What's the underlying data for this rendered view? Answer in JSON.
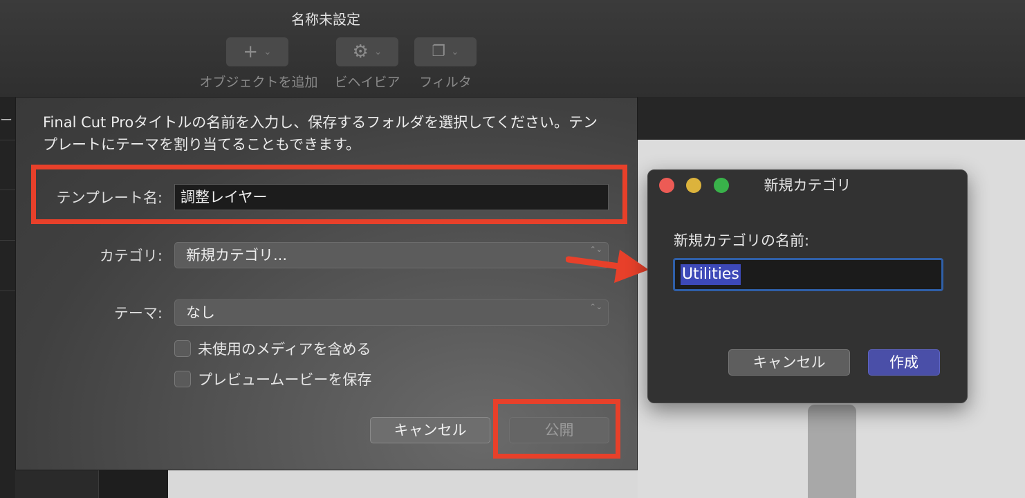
{
  "window": {
    "title": "名称未設定"
  },
  "toolbar": {
    "items": [
      {
        "label": "オブジェクトを追加",
        "icon": "plus-icon",
        "symbol": "+"
      },
      {
        "label": "ビヘイビア",
        "icon": "gear-icon",
        "symbol": "⚙"
      },
      {
        "label": "フィルタ",
        "icon": "filter-icon",
        "symbol": "❐"
      }
    ],
    "chevron": "⌄"
  },
  "background": {
    "left_glyph": "ー"
  },
  "sheet": {
    "description": "Final Cut Proタイトルの名前を入力し、保存するフォルダを選択してください。テンプレートにテーマを割り当てることもできます。",
    "template_name_label": "テンプレート名:",
    "template_name_value": "調整レイヤー",
    "category_label": "カテゴリ:",
    "category_value": "新規カテゴリ...",
    "theme_label": "テーマ:",
    "theme_value": "なし",
    "include_unused_media": "未使用のメディアを含める",
    "save_preview_movie": "プレビュームービーを保存",
    "cancel_button": "キャンセル",
    "publish_button": "公開",
    "popup_arrows": "⌃⌄"
  },
  "new_category_dialog": {
    "title": "新規カテゴリ",
    "name_label": "新規カテゴリの名前:",
    "name_value": "Utilities",
    "cancel_button": "キャンセル",
    "create_button": "作成"
  },
  "colors": {
    "highlight": "#e8402a",
    "accent_button": "#4a4fa8",
    "selection": "#3d49b8"
  }
}
